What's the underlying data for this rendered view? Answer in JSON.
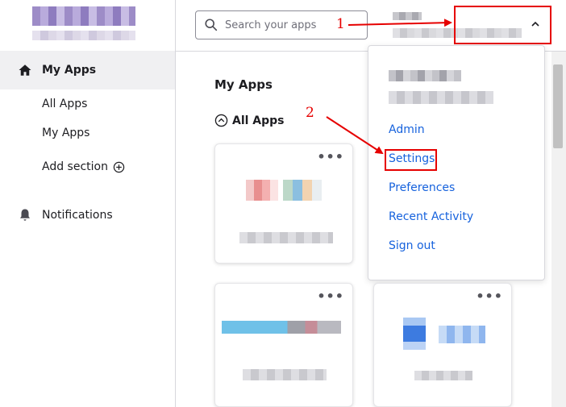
{
  "sidebar": {
    "nav_main": "My Apps",
    "sub_items": [
      "All Apps",
      "My Apps"
    ],
    "add_section": "Add section",
    "notifications": "Notifications"
  },
  "header": {
    "search_placeholder": "Search your apps"
  },
  "user_menu": {
    "items": [
      "Admin",
      "Settings",
      "Preferences",
      "Recent Activity",
      "Sign out"
    ]
  },
  "main": {
    "title": "My Apps",
    "section_label": "All Apps",
    "card_menu": "•••"
  },
  "annotations": {
    "step1": "1",
    "step2": "2"
  },
  "colors": {
    "annotation_red": "#e60000",
    "link_blue": "#1662dd"
  },
  "icons": {
    "home": "home-icon",
    "bell": "bell-icon",
    "plus": "plus-circle-icon",
    "search": "search-icon",
    "chevron": "chevron-up-icon",
    "collapse": "chevron-up-circle-icon",
    "more": "more-dots-icon"
  }
}
